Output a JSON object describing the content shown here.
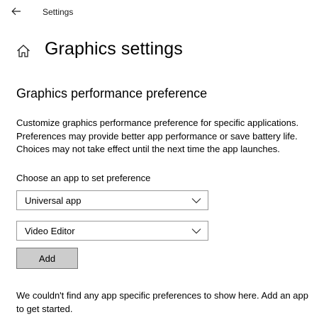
{
  "window": {
    "title": "Settings"
  },
  "header": {
    "page_title": "Graphics settings"
  },
  "section": {
    "title": "Graphics performance preference",
    "description_lines": [
      "Customize graphics performance preference for specific applications.",
      "Preferences may provide better app performance or save battery life.",
      "Choices may not take effect until the next time the app launches."
    ]
  },
  "chooser": {
    "label": "Choose an app to set preference",
    "app_type_select": {
      "selected": "Universal app"
    },
    "app_select": {
      "selected": "Video Editor"
    },
    "add_label": "Add"
  },
  "empty_state": {
    "lines": [
      "We couldn't find any app specific preferences to show here. Add an app",
      "to get started."
    ]
  },
  "icons": {
    "back": "back-arrow-icon",
    "home": "home-icon",
    "dropdown": "chevron-down-icon"
  },
  "colors": {
    "background": "#ffffff",
    "text": "#000000",
    "select_border": "#999999",
    "button_bg": "#cccccc",
    "button_border": "#7a7a7a"
  }
}
